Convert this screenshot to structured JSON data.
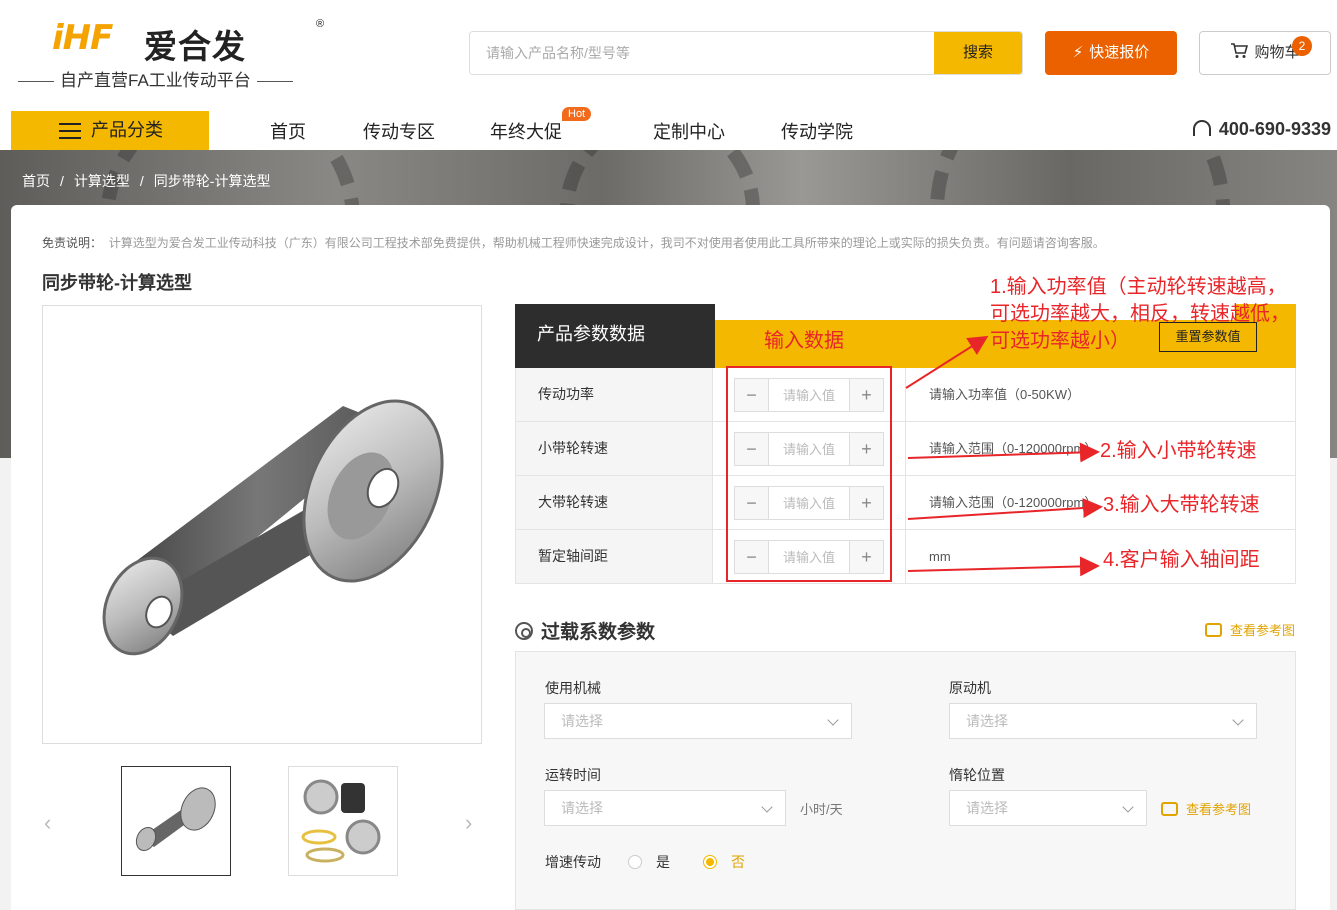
{
  "header": {
    "logo_brand": "iHF",
    "logo_cn": "爱合发",
    "logo_reg": "®",
    "slogan": "自产直营FA工业传动平台",
    "search_placeholder": "请输入产品名称/型号等",
    "search_button": "搜索",
    "quote_button": "快速报价",
    "cart_label": "购物车",
    "cart_count": "2"
  },
  "nav": {
    "category_label": "产品分类",
    "items": [
      "首页",
      "传动专区",
      "年终大促",
      "定制中心",
      "传动学院"
    ],
    "hot_badge": "Hot",
    "phone": "400-690-9339"
  },
  "breadcrumb": [
    "首页",
    "计算选型",
    "同步带轮-计算选型"
  ],
  "breadcrumb_sep": "/",
  "disclaimer": {
    "label": "免责说明：",
    "text": "计算选型为爱合发工业传动科技（广东）有限公司工程技术部免费提供，帮助机械工程师快速完成设计，我司不对使用者使用此工具所带来的理论上或实际的损失负责。有问题请咨询客服。"
  },
  "page_title": "同步带轮-计算选型",
  "params": {
    "header": "产品参数数据",
    "reset_button": "重置参数值",
    "input_placeholder": "请输入值",
    "minus": "−",
    "plus": "+",
    "rows": [
      {
        "label": "传动功率",
        "hint": "请输入功率值（0-50KW）"
      },
      {
        "label": "小带轮转速",
        "hint": "请输入范围（0-120000rpm）"
      },
      {
        "label": "大带轮转速",
        "hint": "请输入范围（0-120000rpm）"
      },
      {
        "label": "暂定轴间距",
        "hint": "mm"
      }
    ]
  },
  "overload": {
    "title": "过载系数参数",
    "ref_link": "查看参考图",
    "machine_label": "使用机械",
    "prime_mover_label": "原动机",
    "runtime_label": "运转时间",
    "idler_label": "惰轮位置",
    "select_placeholder": "请选择",
    "runtime_unit": "小时/天",
    "speedup_label": "增速传动",
    "radio_yes": "是",
    "radio_no": "否",
    "radio_selected": "否"
  },
  "annotations": {
    "input_data": "输入数据",
    "step1_line1": "1.输入功率值（主动轮转速越高，",
    "step1_line2": "可选功率越大，相反，转速越低，",
    "step1_line3": "可选功率越小）",
    "step2": "2.输入小带轮转速",
    "step3": "3.输入大带轮转速",
    "step4": "4.客户输入轴间距",
    "color": "#e8262a"
  },
  "colors": {
    "brand_yellow": "#f5b800",
    "brand_orange": "#eb6100",
    "dark": "#2d2d2d"
  }
}
